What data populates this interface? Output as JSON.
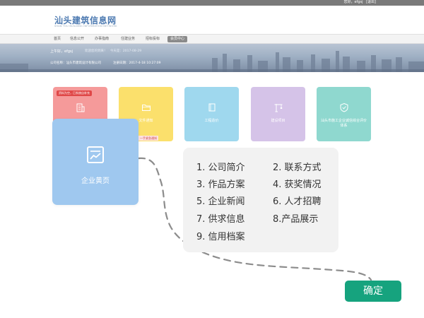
{
  "topbar": {
    "user": "您好，efgsj",
    "logout": "[退出]"
  },
  "header": {
    "logo": "汕头建筑信息网",
    "logo_sub": "SHAN TOU BUILDING INFORMATION NETWORK"
  },
  "nav": {
    "items": [
      {
        "label": "首页",
        "active": false
      },
      {
        "label": "信息公开",
        "active": false
      },
      {
        "label": "办事指南",
        "active": false
      },
      {
        "label": "住建业务",
        "active": false
      },
      {
        "label": "招标投标",
        "active": false
      },
      {
        "label": "会员中心",
        "active": true
      }
    ]
  },
  "banner": {
    "greet": "上午好，",
    "user": "efgsj",
    "welcome": "欢迎您的到来！",
    "date_prefix": "今天是：2017-08-29",
    "company_label": "公司名称：",
    "company_value": "汕头市建筑设计有限公司",
    "login_label": "注册日期：",
    "login_value": "2017-4-18 10:27:09"
  },
  "tiles": [
    {
      "label": "",
      "badge": "资料为空，已系统自补充",
      "color": "#f59a9a"
    },
    {
      "label": "文件通知",
      "notice": "一手紧急通知",
      "color": "#fbe06c"
    },
    {
      "label": "工程造价",
      "color": "#9fd8ee"
    },
    {
      "label": "建设项目",
      "color": "#d5c3e8"
    },
    {
      "label": "汕头市施工企业诚信综合评价体系",
      "color": "#8fd8cf"
    }
  ],
  "big_card": {
    "label": "企业黄页"
  },
  "popup": {
    "items": [
      "1. 公司简介",
      "2. 联系方式",
      "3. 作品方案",
      "4. 获奖情况",
      "5. 企业新闻",
      "6. 人才招聘",
      "7. 供求信息",
      "8.产品展示",
      "9. 信用档案"
    ]
  },
  "confirm": {
    "label": "确定"
  },
  "colors": {
    "accent": "#16a37e",
    "card": "#9fc8ef"
  }
}
